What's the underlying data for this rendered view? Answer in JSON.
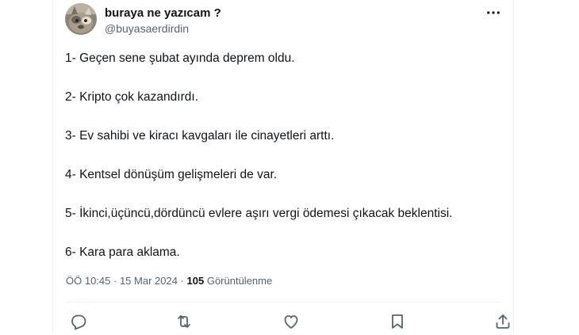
{
  "author": {
    "display_name": "buraya ne yazıcam ?",
    "handle": "@buyasaerdirdin"
  },
  "tweet": {
    "lines": [
      "1- Geçen sene şubat ayında deprem oldu.",
      "2- Kripto çok kazandırdı.",
      "3- Ev sahibi ve kiracı kavgaları ile cinayetleri arttı.",
      "4- Kentsel dönüşüm gelişmeleri de var.",
      "5- İkinci,üçüncü,dördüncü evlere aşırı vergi ödemesi çıkacak beklentisi.",
      "6- Kara para aklama."
    ]
  },
  "meta": {
    "time": "ÖÖ 10:45",
    "separator": " · ",
    "date": "15 Mar 2024",
    "views_count": "105",
    "views_label": "Görüntülenme"
  },
  "icons": {
    "more": "more-dots-icon",
    "reply": "reply-icon",
    "retweet": "retweet-icon",
    "like": "heart-icon",
    "bookmark": "bookmark-icon",
    "share": "share-icon"
  },
  "colors": {
    "text_primary": "#0f1419",
    "text_secondary": "#536471",
    "border": "#eff3f4"
  }
}
